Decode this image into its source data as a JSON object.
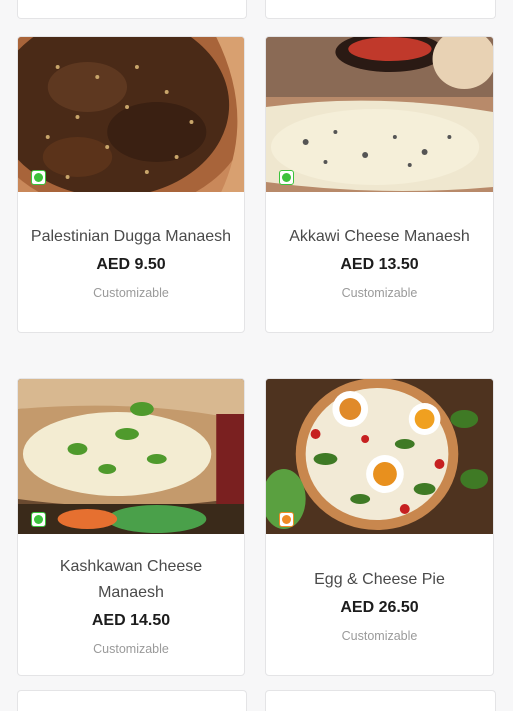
{
  "items": [
    {
      "name": "Palestinian Dugga Manaesh",
      "price": "AED 9.50",
      "tag": "Customizable",
      "indicator": "veg-icon",
      "indicator_color": "#3cc23c"
    },
    {
      "name": "Akkawi Cheese Manaesh",
      "price": "AED 13.50",
      "tag": "Customizable",
      "indicator": "veg-icon",
      "indicator_color": "#3cc23c"
    },
    {
      "name": "Kashkawan Cheese Manaesh",
      "price": "AED 14.50",
      "tag": "Customizable",
      "indicator": "veg-icon",
      "indicator_color": "#3cc23c"
    },
    {
      "name": "Egg & Cheese Pie",
      "price": "AED 26.50",
      "tag": "Customizable",
      "indicator": "egg-icon",
      "indicator_color": "#f08a24"
    }
  ]
}
